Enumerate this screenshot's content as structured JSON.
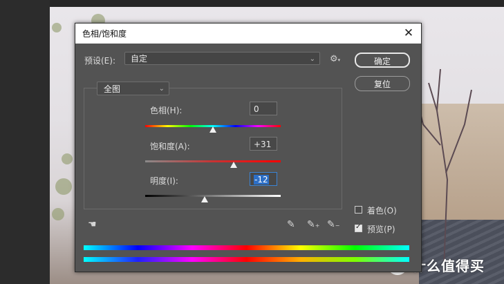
{
  "dialog": {
    "title": "色相/饱和度",
    "close_glyph": "✕",
    "preset_label": "预设(E):",
    "preset_value": "自定",
    "ok_label": "确定",
    "reset_label": "复位",
    "channel_value": "全图",
    "hue": {
      "label": "色相(H):",
      "value": "0",
      "level": 0.5
    },
    "saturation": {
      "label": "饱和度(A):",
      "value": "+31",
      "level": 0.655
    },
    "lightness": {
      "label": "明度(I):",
      "value": "-12",
      "level": 0.44
    },
    "colorize_label": "着色(O)",
    "colorize_checked": false,
    "preview_label": "预览(P)",
    "preview_checked": true
  },
  "watermark": {
    "text": "什么值得买",
    "logo_glyph": "值"
  },
  "icons": [
    "gear-icon",
    "targeted-adjustment-icon",
    "eyedropper-icon",
    "eyedropper-plus-icon",
    "eyedropper-minus-icon",
    "close-icon",
    "chevron-down-icon"
  ]
}
